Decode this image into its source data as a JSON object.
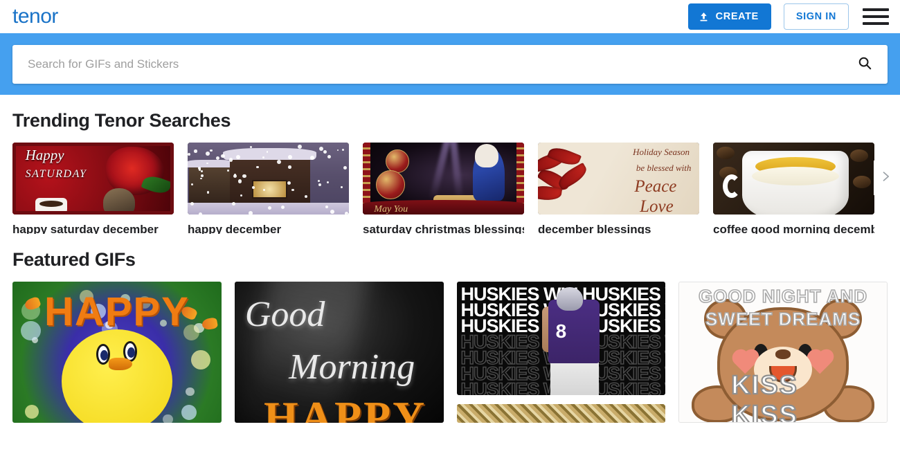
{
  "header": {
    "logo_text": "tenor",
    "logo_color": "#1a73c7",
    "create_label": "CREATE",
    "signin_label": "SIGN IN",
    "upload_icon": "upload-icon",
    "menu_icon": "hamburger-menu-icon"
  },
  "search": {
    "placeholder": "Search for GIFs and Stickers",
    "value": "",
    "icon": "search-icon",
    "banner_color": "#45a0ef"
  },
  "trending": {
    "title": "Trending Tenor Searches",
    "next_icon": "chevron-right-icon",
    "items": [
      {
        "label": "happy saturday december",
        "art": "saturday",
        "art_text": {
          "line1": "Happy",
          "line2": "SATURDAY"
        }
      },
      {
        "label": "happy december",
        "art": "snow",
        "art_text": {}
      },
      {
        "label": "saturday christmas blessings",
        "art": "nativity",
        "art_text": {
          "banner": "May You"
        }
      },
      {
        "label": "december blessings",
        "art": "peace",
        "art_text": {
          "l1": "Holiday Season",
          "l2": "be blessed with",
          "l3": "Peace",
          "l4": "Love"
        }
      },
      {
        "label": "coffee good morning december",
        "art": "coffee",
        "art_text": {}
      }
    ]
  },
  "featured": {
    "title": "Featured GIFs",
    "columns": [
      {
        "tiles": [
          {
            "art": "tweety",
            "art_text": {
              "main": "HAPPY"
            }
          }
        ]
      },
      {
        "tiles": [
          {
            "art": "goodmorning",
            "art_text": {
              "l1": "Good",
              "l2": "Morning",
              "l3": "HAPPY"
            }
          }
        ]
      },
      {
        "tiles": [
          {
            "art": "huskies",
            "art_text": {
              "chant": "HUSKIES WIN",
              "jersey_number": "8"
            }
          },
          {
            "art": "gold",
            "art_text": {}
          }
        ]
      },
      {
        "tiles": [
          {
            "art": "bear",
            "art_text": {
              "top": "GOOD NIGHT AND SWEET DREAMS",
              "bottom": "KISS KISS"
            }
          }
        ]
      }
    ]
  }
}
